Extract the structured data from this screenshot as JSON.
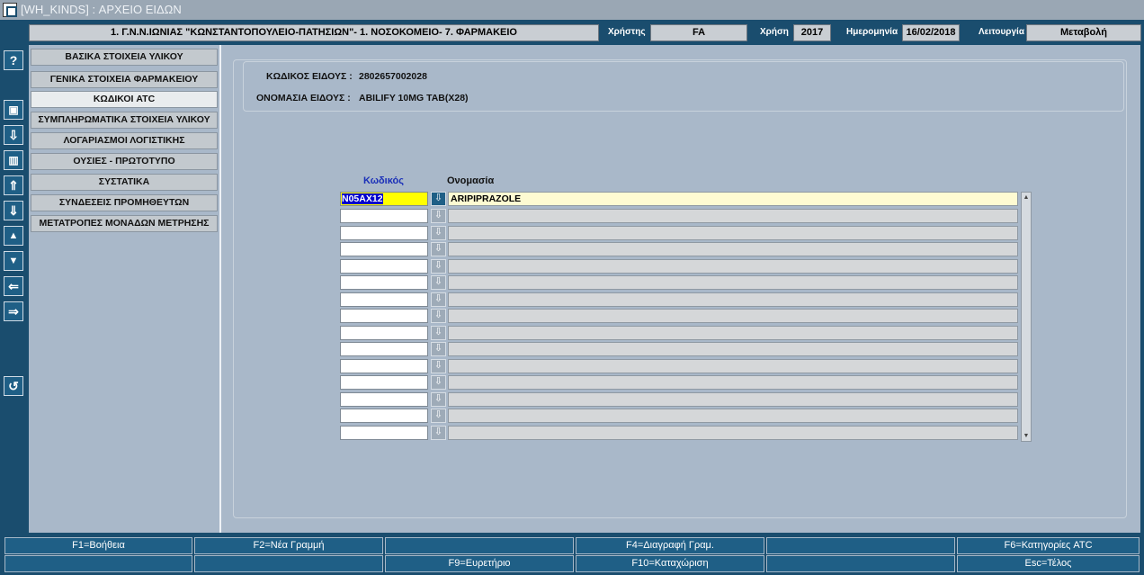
{
  "window": {
    "title": "[WH_KINDS]  :  ΑΡΧΕΙΟ ΕΙΔΩΝ"
  },
  "header": {
    "organization": "1. Γ.Ν.Ν.ΙΩΝΙΑΣ \"ΚΩΝΣΤΑΝΤΟΠΟΥΛΕΙΟ-ΠΑΤΗΣΙΩΝ\"- 1. ΝΟΣΟΚΟΜΕΙΟ- 7. ΦΑΡΜΑΚΕΙΟ",
    "user_label": "Χρήστης",
    "user_value": "FA",
    "year_label": "Χρήση",
    "year_value": "2017",
    "date_label": "Ημερομηνία",
    "date_value": "16/02/2018",
    "mode_label": "Λειτουργία",
    "mode_value": "Μεταβολή"
  },
  "toolbar": {
    "icons": [
      "help-icon",
      "save-icon",
      "download-icon",
      "trash-icon",
      "first-record-icon",
      "last-record-icon",
      "prev-record-icon",
      "next-record-icon",
      "prev-block-icon",
      "next-block-icon",
      "undo-icon"
    ],
    "help_glyph": "?",
    "save_glyph": "▣",
    "download_glyph": "⇩",
    "trash_glyph": "▥",
    "first_glyph": "⇑",
    "last_glyph": "⇓",
    "prev_glyph": "▲",
    "next_glyph": "▼",
    "prevblock_glyph": "⇐",
    "nextblock_glyph": "⇒",
    "undo_glyph": "↺"
  },
  "sidebar": {
    "items": [
      {
        "label": "ΒΑΣΙΚΑ ΣΤΟΙΧΕΙΑ ΥΛΙΚΟΥ"
      },
      {
        "label": "ΓΕΝΙΚΑ ΣΤΟΙΧΕΙΑ ΦΑΡΜΑΚΕΙΟΥ"
      },
      {
        "label": "ΚΩΔΙΚΟΙ ATC"
      },
      {
        "label": "ΣΥΜΠΛΗΡΩΜΑΤΙΚΑ ΣΤΟΙΧΕΙΑ ΥΛΙΚΟΥ"
      },
      {
        "label": "ΛΟΓΑΡΙΑΣΜΟΙ ΛΟΓΙΣΤΙΚΗΣ"
      },
      {
        "label": "ΟΥΣΙΕΣ - ΠΡΩΤΟΤΥΠΟ"
      },
      {
        "label": "ΣΥΣΤΑΤΙΚΑ"
      },
      {
        "label": "ΣΥΝΔΕΣΕΙΣ ΠΡΟΜΗΘΕΥΤΩΝ"
      },
      {
        "label": "ΜΕΤΑΤΡΟΠΕΣ ΜΟΝΑΔΩΝ ΜΕΤΡΗΣΗΣ"
      }
    ],
    "active_index": 2
  },
  "item": {
    "code_label": "ΚΩΔΙΚΟΣ ΕΙΔΟΥΣ :",
    "code_value": "2802657002028",
    "name_label": "ΟΝΟΜΑΣΙΑ ΕΙΔΟΥΣ :",
    "name_value": "ABILIFY 10MG TAB(X28)"
  },
  "grid": {
    "col_code": "Κωδικός",
    "col_name": "Ονομασία",
    "lookup_glyph": "⇩",
    "rows": [
      {
        "code": "N05AX12",
        "name": "ARIPIPRAZOLE"
      },
      {
        "code": "",
        "name": ""
      },
      {
        "code": "",
        "name": ""
      },
      {
        "code": "",
        "name": ""
      },
      {
        "code": "",
        "name": ""
      },
      {
        "code": "",
        "name": ""
      },
      {
        "code": "",
        "name": ""
      },
      {
        "code": "",
        "name": ""
      },
      {
        "code": "",
        "name": ""
      },
      {
        "code": "",
        "name": ""
      },
      {
        "code": "",
        "name": ""
      },
      {
        "code": "",
        "name": ""
      },
      {
        "code": "",
        "name": ""
      },
      {
        "code": "",
        "name": ""
      },
      {
        "code": "",
        "name": ""
      }
    ]
  },
  "fkeys": {
    "row1": [
      "F1=Βοήθεια",
      "F2=Νέα Γραμμή",
      "",
      "F4=Διαγραφή Γραμ.",
      "",
      "F6=Κατηγορίες ATC"
    ],
    "row2": [
      "",
      "",
      "F9=Ευρετήριο",
      "F10=Καταχώριση",
      "",
      "Esc=Τέλος"
    ]
  },
  "colors": {
    "frame_bg": "#1a4d6e",
    "panel_bg": "#a9b8c9",
    "highlight_yellow": "#ffff00",
    "selection_blue": "#0000cc"
  }
}
